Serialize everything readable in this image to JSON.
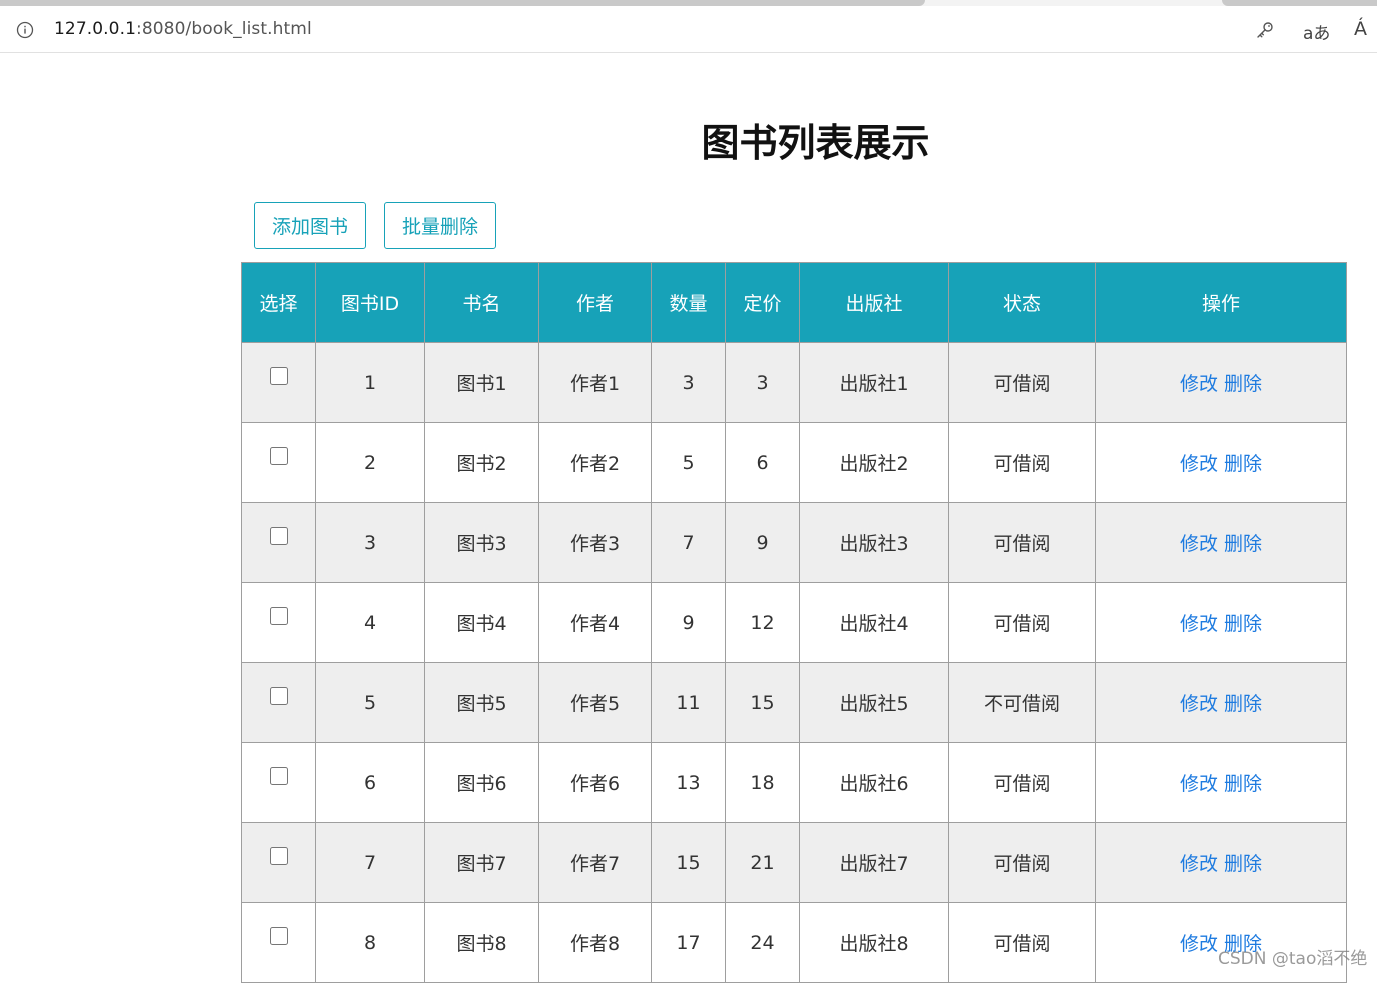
{
  "browser": {
    "url_host": "127.0.0.1",
    "url_rest": ":8080/book_list.html",
    "icons": {
      "site_info": "info-icon",
      "password": "key-icon",
      "translate": "translate-icon",
      "read_aloud": "read-aloud-icon"
    },
    "translate_glyph": "aあ",
    "read_glyph": "Á"
  },
  "page": {
    "title": "图书列表展示",
    "add_button": "添加图书",
    "batch_delete_button": "批量删除",
    "accent_color": "#17a2b8",
    "link_color": "#1e7be0"
  },
  "table": {
    "headers": [
      "选择",
      "图书ID",
      "书名",
      "作者",
      "数量",
      "定价",
      "出版社",
      "状态",
      "操作"
    ],
    "edit_label": "修改",
    "delete_label": "删除",
    "rows": [
      {
        "id": "1",
        "name": "图书1",
        "author": "作者1",
        "count": "3",
        "price": "3",
        "publisher": "出版社1",
        "status": "可借阅"
      },
      {
        "id": "2",
        "name": "图书2",
        "author": "作者2",
        "count": "5",
        "price": "6",
        "publisher": "出版社2",
        "status": "可借阅"
      },
      {
        "id": "3",
        "name": "图书3",
        "author": "作者3",
        "count": "7",
        "price": "9",
        "publisher": "出版社3",
        "status": "可借阅"
      },
      {
        "id": "4",
        "name": "图书4",
        "author": "作者4",
        "count": "9",
        "price": "12",
        "publisher": "出版社4",
        "status": "可借阅"
      },
      {
        "id": "5",
        "name": "图书5",
        "author": "作者5",
        "count": "11",
        "price": "15",
        "publisher": "出版社5",
        "status": "不可借阅"
      },
      {
        "id": "6",
        "name": "图书6",
        "author": "作者6",
        "count": "13",
        "price": "18",
        "publisher": "出版社6",
        "status": "可借阅"
      },
      {
        "id": "7",
        "name": "图书7",
        "author": "作者7",
        "count": "15",
        "price": "21",
        "publisher": "出版社7",
        "status": "可借阅"
      },
      {
        "id": "8",
        "name": "图书8",
        "author": "作者8",
        "count": "17",
        "price": "24",
        "publisher": "出版社8",
        "status": "可借阅"
      }
    ]
  },
  "watermark": "CSDN @tao滔不绝"
}
